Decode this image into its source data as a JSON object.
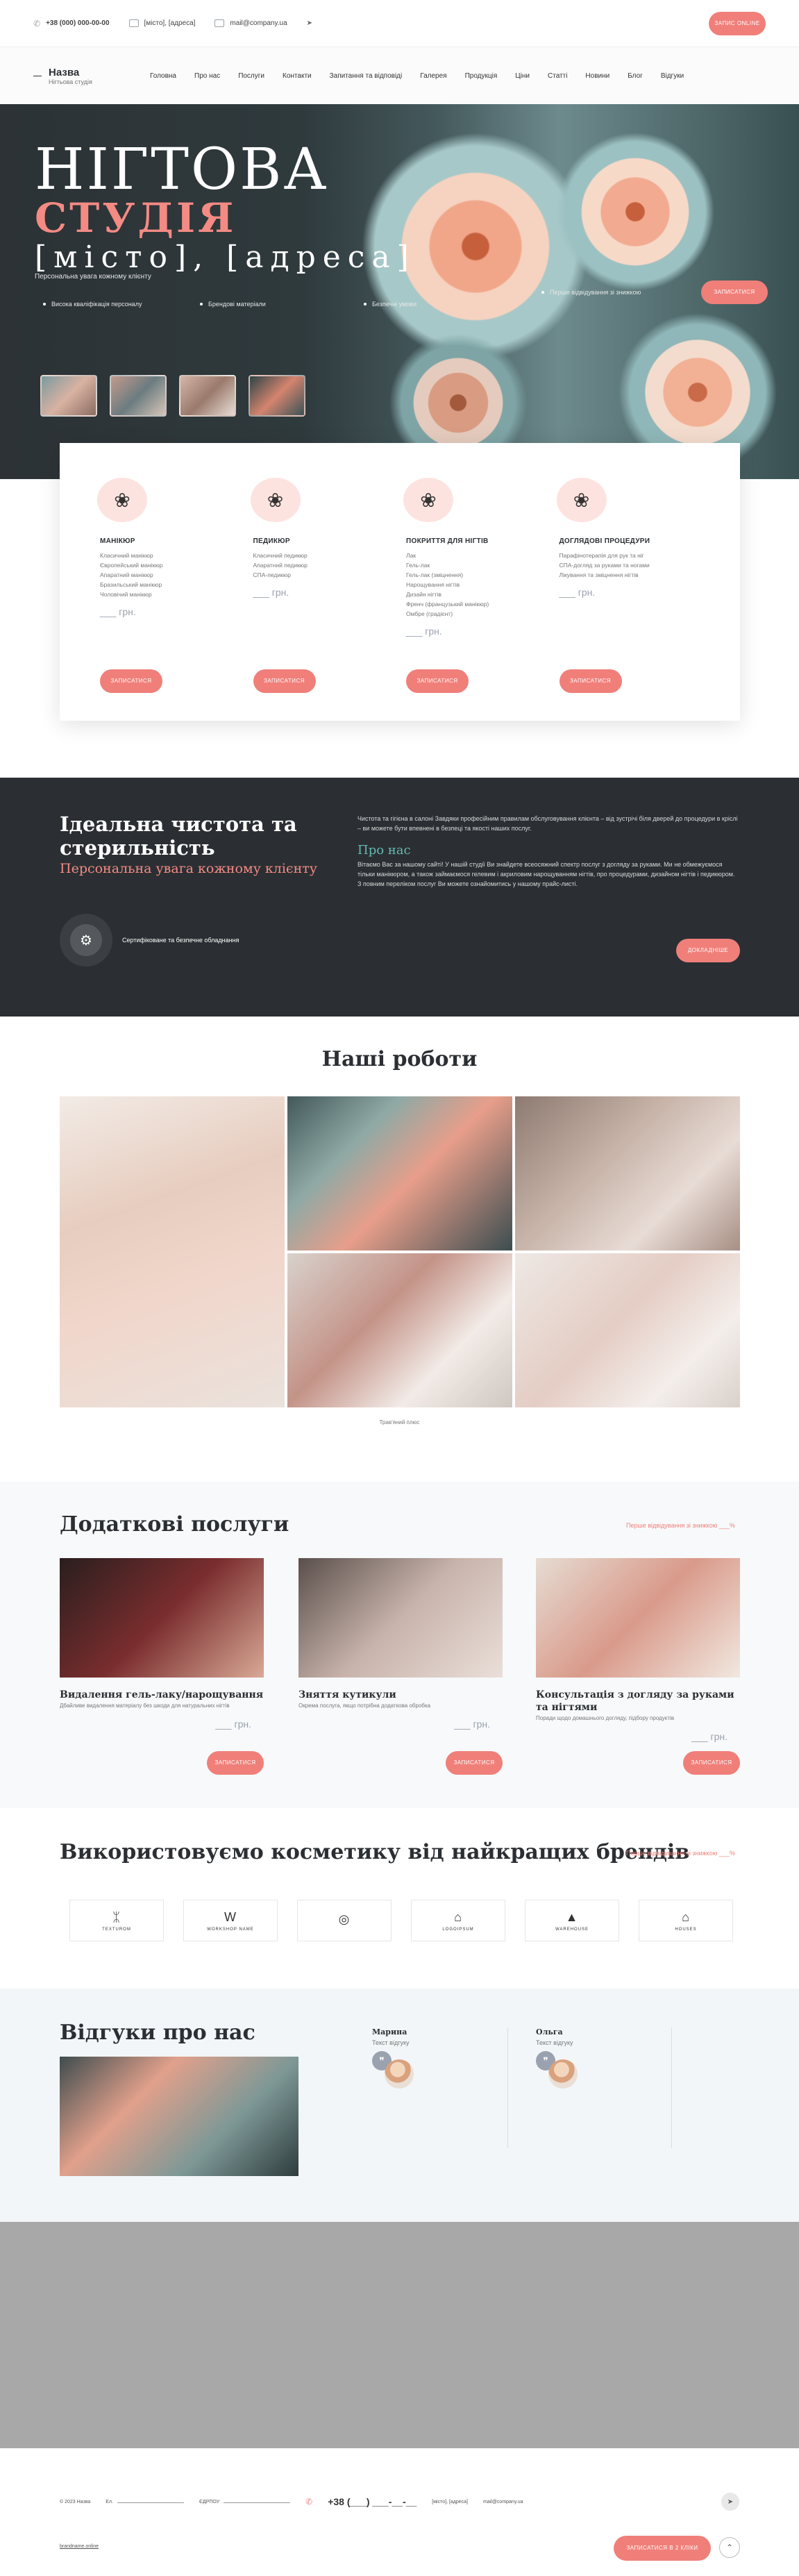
{
  "topbar": {
    "phone": "+38 (000) 000-00-00",
    "address": "[місто], [адреса]",
    "email": "mail@company.ua",
    "book_label": "Запис online"
  },
  "nav": {
    "logo_name": "Назва",
    "logo_sub": "Нігтьова студія",
    "items": [
      "Головна",
      "Про нас",
      "Послуги",
      "Контакти",
      "Запитання та відповіді",
      "Галерея",
      "Продукція",
      "Ціни",
      "Статті",
      "Новини",
      "Блог",
      "Відгуки"
    ]
  },
  "hero": {
    "title1": "НІГТОВА",
    "title2": "СТУДІЯ",
    "address": "[місто], [адреса]",
    "tagline": "Персональна увага кожному клієнту",
    "features": [
      "Висока кваліфікація персоналу",
      "Брендові матеріали",
      "Безпечні умови",
      "Перше відвідування зі знижкою"
    ],
    "cta": "Записатися"
  },
  "services": [
    {
      "title": "МАНІКЮР",
      "lines": [
        "Класичний манікюр",
        "Європейський манікюр",
        "Апаратний манікюр",
        "Бразильський манікюр",
        "Чоловічий манікюр"
      ],
      "price": "___ грн.",
      "cta": "Записатися"
    },
    {
      "title": "ПЕДИКЮР",
      "lines": [
        "Класичний педикюр",
        "Апаратний педикюр",
        "СПА-педикюр"
      ],
      "price": "___ грн.",
      "cta": "Записатися"
    },
    {
      "title": "ПОКРИТТЯ ДЛЯ НІГТІВ",
      "lines": [
        "Лак",
        "Гель-лак",
        "Гель-лак (зміцнення)",
        "Нарощування нігтів",
        "Дизайн нігтів",
        "Френч (французький манікюр)",
        "Омбре (градієнт)"
      ],
      "price": "___ грн.",
      "cta": "Записатися"
    },
    {
      "title": "ДОГЛЯДОВІ ПРОЦЕДУРИ",
      "lines": [
        "Парафінотерапія для рук та ніг",
        "СПА-догляд за руками та ногами",
        "Лікування та зміцнення нігтів"
      ],
      "price": "___ грн.",
      "cta": "Записатися"
    }
  ],
  "about": {
    "title": "Ідеальна чистота та стерильність",
    "subtitle": "Персональна увага кожному клієнту",
    "cert": "Сертифіковане та безпечне обладнання",
    "intro": "Чистота та гігієна в салоні Завдяки професійним правилам обслуговування клієнта – від зустрічі біля дверей до процедури в кріслі – ви можете бути впевнені в безпеці та якості наших послуг.",
    "about_title": "Про нас",
    "about_text": "Вітаємо Вас за нашому сайті! У нашій студії Ви знайдете всеосяжний спектр послуг з догляду за руками. Ми не обмежуємося тільки манікюром, а також займаємося гелевим і акриловим нарощуванням нігтів, про процедурами, дизайном нігтів і педикюром. З повним переліком послуг Ви можете ознайомитись у нашому прайс-листі.",
    "cta": "Докладніше"
  },
  "gallery": {
    "title": "Наші роботи",
    "caption": "Трав'яний плюс"
  },
  "extra": {
    "title": "Додаткові послуги",
    "link": "Перше відвідування зі знижкою ___%",
    "items": [
      {
        "title": "Видалення гель-лаку/нарощування",
        "desc": "Дбайливе видалення матеріалу без шкоди для натуральних нігтів",
        "price": "___ грн.",
        "cta": "Записатися"
      },
      {
        "title": "Зняття кутикули",
        "desc": "Окрема послуга, якщо потрібна додаткова обробка",
        "price": "___ грн.",
        "cta": "Записатися"
      },
      {
        "title": "Консультація з догляду за руками та нігтями",
        "desc": "Поради щодо домашнього догляду, підбору продуктів",
        "price": "___ грн.",
        "cta": "Записатися"
      }
    ]
  },
  "brands": {
    "title": "Використовуємо косметику від найкращих брендів",
    "link": "Перше відвідування зі знижкою ___%",
    "items": [
      {
        "glyph": "ᛯ",
        "name": "TEXTUROM"
      },
      {
        "glyph": "W",
        "name": "WORKSHOP NAME"
      },
      {
        "glyph": "◎",
        "name": ""
      },
      {
        "glyph": "⌂",
        "name": "LOGOIPSUM"
      },
      {
        "glyph": "▲",
        "name": "WAREHOUSE"
      },
      {
        "glyph": "⌂",
        "name": "HOUSES"
      }
    ]
  },
  "reviews": {
    "title": "Відгуки про нас",
    "items": [
      {
        "name": "Марина",
        "text": "Текст відгуку"
      },
      {
        "name": "Ольга",
        "text": "Текст відгуку"
      }
    ]
  },
  "footer": {
    "copy_date": "© 2023 Назва",
    "company_label": "Ел.",
    "edrpou_label": "ЄДРПОУ",
    "phone": "+38 (___) ___-__-__",
    "address": "[місто], [адреса]",
    "email": "mail@company.ua",
    "tg_icon": "telegram-icon",
    "copyright": "brandname.online",
    "cta": "Записатися в 2 кліки",
    "up_icon": "arrow-up-icon"
  },
  "colors": {
    "accent": "#f07f7a",
    "dark": "#2b2f33",
    "teal": "#63b9b1"
  }
}
